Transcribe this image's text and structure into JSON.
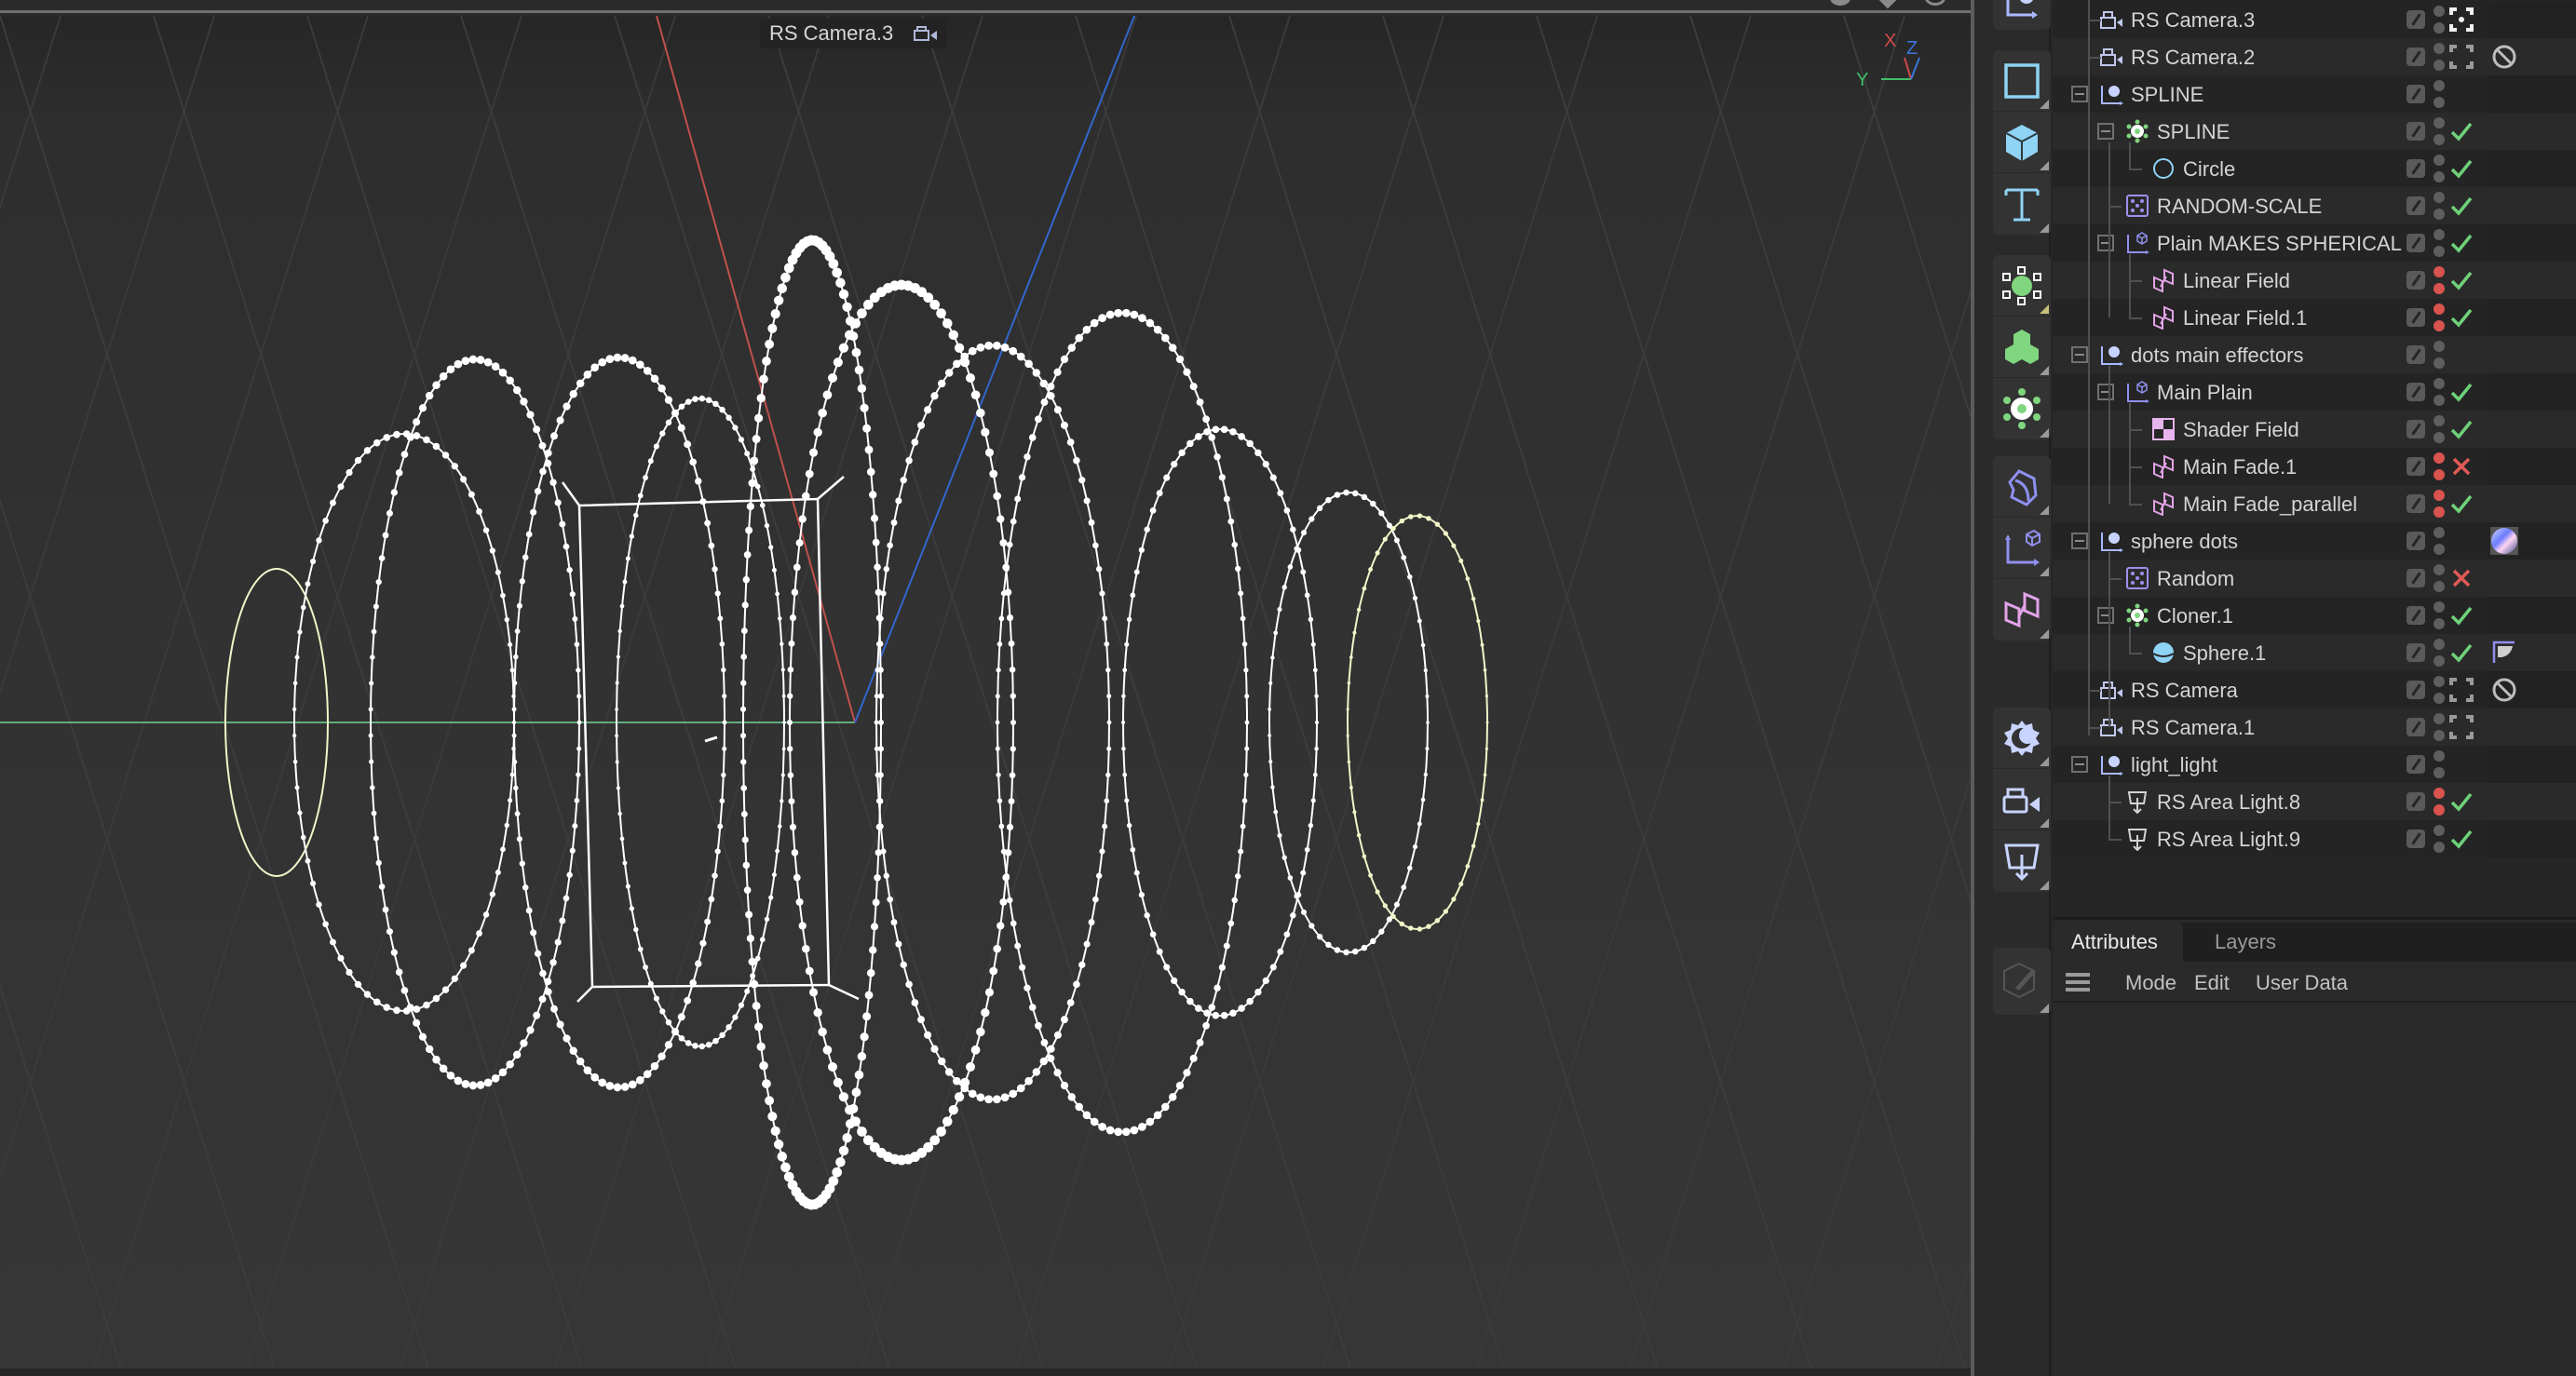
{
  "viewport": {
    "camera_label": "RS Camera.3",
    "camera_icon": "camera-icon",
    "axis_gizmo": {
      "x": "X",
      "y": "Y",
      "z": "Z",
      "x_color": "#d24a4a",
      "y_color": "#3fbf6a",
      "z_color": "#3a78d8"
    },
    "axis_colors": {
      "x": "#c0504d",
      "y": "#5fae7a",
      "z": "#3366cc"
    },
    "object_color": "#ffffff",
    "selected_spline_color": "#f2f5c8"
  },
  "toolbar": {
    "items": [
      {
        "icon": "null-group-icon",
        "color": "#aab8ff"
      },
      {
        "icon": "spline-rectangle-icon",
        "color": "#8fd3f5"
      },
      {
        "icon": "cube-icon",
        "color": "#8fd3f5"
      },
      {
        "icon": "text-icon",
        "color": "#8fd3f5"
      },
      {
        "icon": "generator-icon",
        "color": "#7fd67f"
      },
      {
        "icon": "mograph-cubes-icon",
        "color": "#7fd67f"
      },
      {
        "icon": "cloner-icon",
        "color": "#7fd67f"
      },
      {
        "icon": "deformer-icon",
        "color": "#8f8fef"
      },
      {
        "icon": "effector-icon",
        "color": "#8f8fef"
      },
      {
        "icon": "field-icon",
        "color": "#e3a3e8"
      },
      {
        "icon": "environment-icon",
        "color": "#c8d4ff"
      },
      {
        "icon": "camera-icon",
        "color": "#c8d4ff"
      },
      {
        "icon": "light-icon",
        "color": "#c8d4ff"
      },
      {
        "icon": "edit-tool-icon",
        "color": "#555555"
      }
    ]
  },
  "outliner": {
    "rows": [
      {
        "name": "RS Camera.3",
        "icon": "camera-icon",
        "depth": 0,
        "expand": false,
        "dots": "gray",
        "state": "camera-active",
        "tag": ""
      },
      {
        "name": "RS Camera.2",
        "icon": "camera-icon",
        "depth": 0,
        "expand": false,
        "dots": "gray",
        "state": "camera-inactive",
        "tag": "no-entry-tag"
      },
      {
        "name": "SPLINE",
        "icon": "null-icon",
        "depth": 0,
        "expand": true,
        "dots": "gray",
        "state": "",
        "tag": ""
      },
      {
        "name": "SPLINE",
        "icon": "cloner-icon",
        "depth": 1,
        "expand": true,
        "dots": "gray",
        "state": "check",
        "tag": ""
      },
      {
        "name": "Circle",
        "icon": "circle-spline-icon",
        "depth": 2,
        "expand": false,
        "dots": "gray",
        "state": "check",
        "tag": ""
      },
      {
        "name": "RANDOM-SCALE",
        "icon": "random-effector-icon",
        "depth": 1,
        "expand": false,
        "dots": "gray",
        "state": "check",
        "tag": ""
      },
      {
        "name": "Plain MAKES SPHERICAL",
        "icon": "plain-effector-icon",
        "depth": 1,
        "expand": true,
        "dots": "gray",
        "state": "check",
        "tag": ""
      },
      {
        "name": "Linear Field",
        "icon": "linear-field-icon",
        "depth": 2,
        "expand": false,
        "dots": "red",
        "state": "check",
        "tag": ""
      },
      {
        "name": "Linear Field.1",
        "icon": "linear-field-icon",
        "depth": 2,
        "expand": false,
        "dots": "red",
        "state": "check",
        "tag": ""
      },
      {
        "name": "dots main effectors",
        "icon": "null-icon",
        "depth": 0,
        "expand": true,
        "dots": "gray",
        "state": "",
        "tag": ""
      },
      {
        "name": "Main Plain",
        "icon": "plain-effector-icon",
        "depth": 1,
        "expand": true,
        "dots": "gray",
        "state": "check",
        "tag": ""
      },
      {
        "name": "Shader Field",
        "icon": "shader-field-icon",
        "depth": 2,
        "expand": false,
        "dots": "gray",
        "state": "check",
        "tag": ""
      },
      {
        "name": "Main Fade.1",
        "icon": "linear-field-icon",
        "depth": 2,
        "expand": false,
        "dots": "red",
        "state": "cross",
        "tag": ""
      },
      {
        "name": "Main Fade_parallel",
        "icon": "linear-field-icon",
        "depth": 2,
        "expand": false,
        "dots": "red",
        "state": "check",
        "tag": ""
      },
      {
        "name": "sphere dots",
        "icon": "null-icon",
        "depth": 0,
        "expand": true,
        "dots": "gray",
        "state": "",
        "tag": "material-tag"
      },
      {
        "name": "Random",
        "icon": "random-effector-icon",
        "depth": 1,
        "expand": false,
        "dots": "gray",
        "state": "cross",
        "tag": ""
      },
      {
        "name": "Cloner.1",
        "icon": "cloner-icon",
        "depth": 1,
        "expand": true,
        "dots": "gray",
        "state": "check",
        "tag": ""
      },
      {
        "name": "Sphere.1",
        "icon": "sphere-icon",
        "depth": 2,
        "expand": false,
        "dots": "gray",
        "state": "check",
        "tag": "phong-tag"
      },
      {
        "name": "RS Camera",
        "icon": "camera-icon",
        "depth": 0,
        "expand": false,
        "dots": "gray",
        "state": "camera-inactive",
        "tag": "no-entry-tag"
      },
      {
        "name": "RS Camera.1",
        "icon": "camera-icon",
        "depth": 0,
        "expand": false,
        "dots": "gray",
        "state": "camera-inactive",
        "tag": ""
      },
      {
        "name": "light_light",
        "icon": "null-icon",
        "depth": 0,
        "expand": true,
        "dots": "gray",
        "state": "",
        "tag": ""
      },
      {
        "name": "RS Area Light.8",
        "icon": "area-light-icon",
        "depth": 1,
        "expand": false,
        "dots": "red",
        "state": "check",
        "tag": ""
      },
      {
        "name": "RS Area Light.9",
        "icon": "area-light-icon",
        "depth": 1,
        "expand": false,
        "dots": "gray",
        "state": "check",
        "tag": ""
      }
    ]
  },
  "attributes": {
    "tabs": [
      {
        "label": "Attributes",
        "active": true
      },
      {
        "label": "Layers",
        "active": false
      }
    ],
    "menu_icon": "hamburger-menu-icon",
    "menu": [
      "Mode",
      "Edit",
      "User Data"
    ]
  },
  "colors": {
    "check": "#6fd17a",
    "cross": "#e05a55",
    "red_dot": "#d9534f",
    "gray_dot": "#5e5e5e"
  }
}
